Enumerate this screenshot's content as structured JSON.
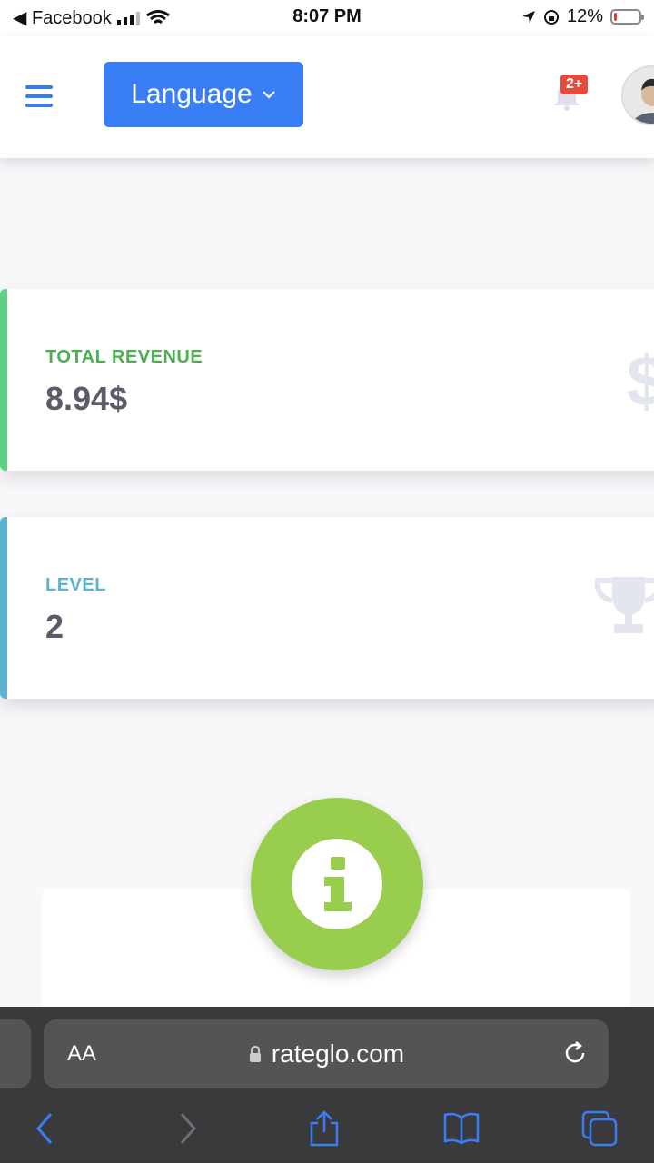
{
  "status_bar": {
    "back_app": "◀ Facebook",
    "time": "8:07 PM",
    "battery": "12%",
    "battery_level": 0.12
  },
  "header": {
    "language_label": "Language",
    "notification_badge": "2+"
  },
  "cards": {
    "revenue": {
      "label": "TOTAL REVENUE",
      "value": "8.94$",
      "icon": "$"
    },
    "level": {
      "label": "LEVEL",
      "value": "2"
    }
  },
  "browser": {
    "aa_label": "AA",
    "url": "rateglo.com"
  },
  "colors": {
    "primary": "#3a7ef5",
    "revenue_accent": "#5fcf86",
    "level_accent": "#5bb3cf",
    "info_green": "#98cd4d",
    "badge_red": "#e74a3b"
  }
}
